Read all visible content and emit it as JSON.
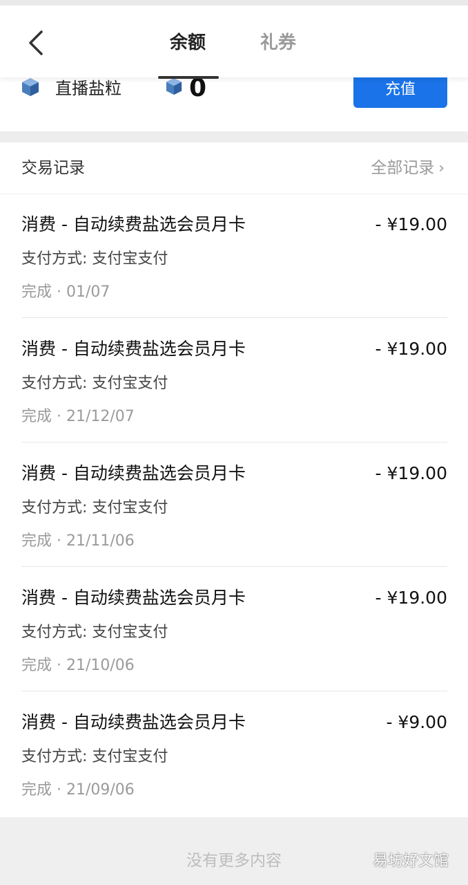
{
  "header": {
    "tabs": [
      {
        "label": "余额",
        "active": true
      },
      {
        "label": "礼券",
        "active": false
      }
    ]
  },
  "balance": {
    "label": "直播盐粒",
    "value": "0",
    "recharge_label": "充值",
    "gem_color": "#4a7ebb",
    "accent": "#1a73e8"
  },
  "records": {
    "title": "交易记录",
    "all_label": "全部记录",
    "items": [
      {
        "title": "消费 - 自动续费盐选会员月卡",
        "amount": "- ¥19.00",
        "payment": "支付方式:  支付宝支付",
        "status": "完成 · 01/07"
      },
      {
        "title": "消费 - 自动续费盐选会员月卡",
        "amount": "- ¥19.00",
        "payment": "支付方式:  支付宝支付",
        "status": "完成 · 21/12/07"
      },
      {
        "title": "消费 - 自动续费盐选会员月卡",
        "amount": "- ¥19.00",
        "payment": "支付方式:  支付宝支付",
        "status": "完成 · 21/11/06"
      },
      {
        "title": "消费 - 自动续费盐选会员月卡",
        "amount": "- ¥19.00",
        "payment": "支付方式:  支付宝支付",
        "status": "完成 · 21/10/06"
      },
      {
        "title": "消费 - 自动续费盐选会员月卡",
        "amount": "- ¥9.00",
        "payment": "支付方式:  支付宝支付",
        "status": "完成 · 21/09/06"
      }
    ]
  },
  "footer": {
    "no_more": "没有更多内容",
    "watermark": "易坊好文馆"
  }
}
